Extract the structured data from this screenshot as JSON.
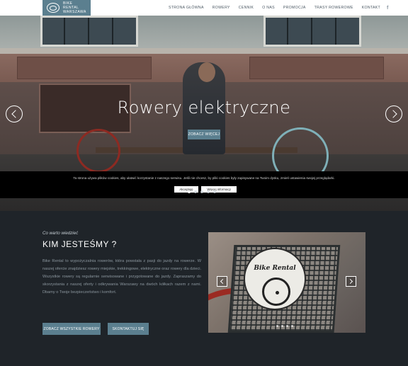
{
  "nav": {
    "logo_lines": [
      "BIKE",
      "RENTAL",
      "WARSZAWA"
    ],
    "items": [
      "STRONA GŁÓWNA",
      "ROWERY",
      "CENNIK",
      "O NAS",
      "PROMOCJA",
      "TRASY ROWEROWE",
      "KONTAKT"
    ],
    "social_icon": "f"
  },
  "hero": {
    "title": "Rowery elektryczne",
    "button_label": "ZOBACZ WIĘCEJ",
    "slide_count": 5,
    "active_slide": 0
  },
  "cookie": {
    "text": "Ta strona używa plików cookies, aby ułatwić korzystanie z naszego serwisu. Jeśli nie chcesz, by pliki cookies były zapisywane na Twoim dysku, zmień ustawienia swojej przeglądarki.",
    "accept_label": "Akceptuję",
    "more_label": "Więcej informacji"
  },
  "about": {
    "kicker": "Co warto wiedzieć",
    "heading": "KIM JESTEŚMY ?",
    "paragraph": "Bike Rental to wypożyczalnia rowerów, która powstała z pasji do jazdy na rowerze. W naszej ofercie znajdziesz rowery miejskie, trekkingowe, elektryczne oraz rowery dla dzieci. Wszystkie rowery są regularnie serwisowane i przygotowane do jazdy. Zapraszamy do skorzystania z naszej oferty i odkrywania Warszawy na dwóch kółkach razem z nami. Dbamy o Twoje bezpieczeństwo i komfort.",
    "button_primary": "ZOBACZ WSZYSTKIE ROWERY",
    "button_secondary": "SKONTAKTUJ SIĘ",
    "photo_badge": "Bike Rental",
    "photo_slide_count": 4
  },
  "colors": {
    "accent": "#5b7f8f",
    "dark_bg": "#1f2429",
    "cookie_bg": "#000000"
  }
}
